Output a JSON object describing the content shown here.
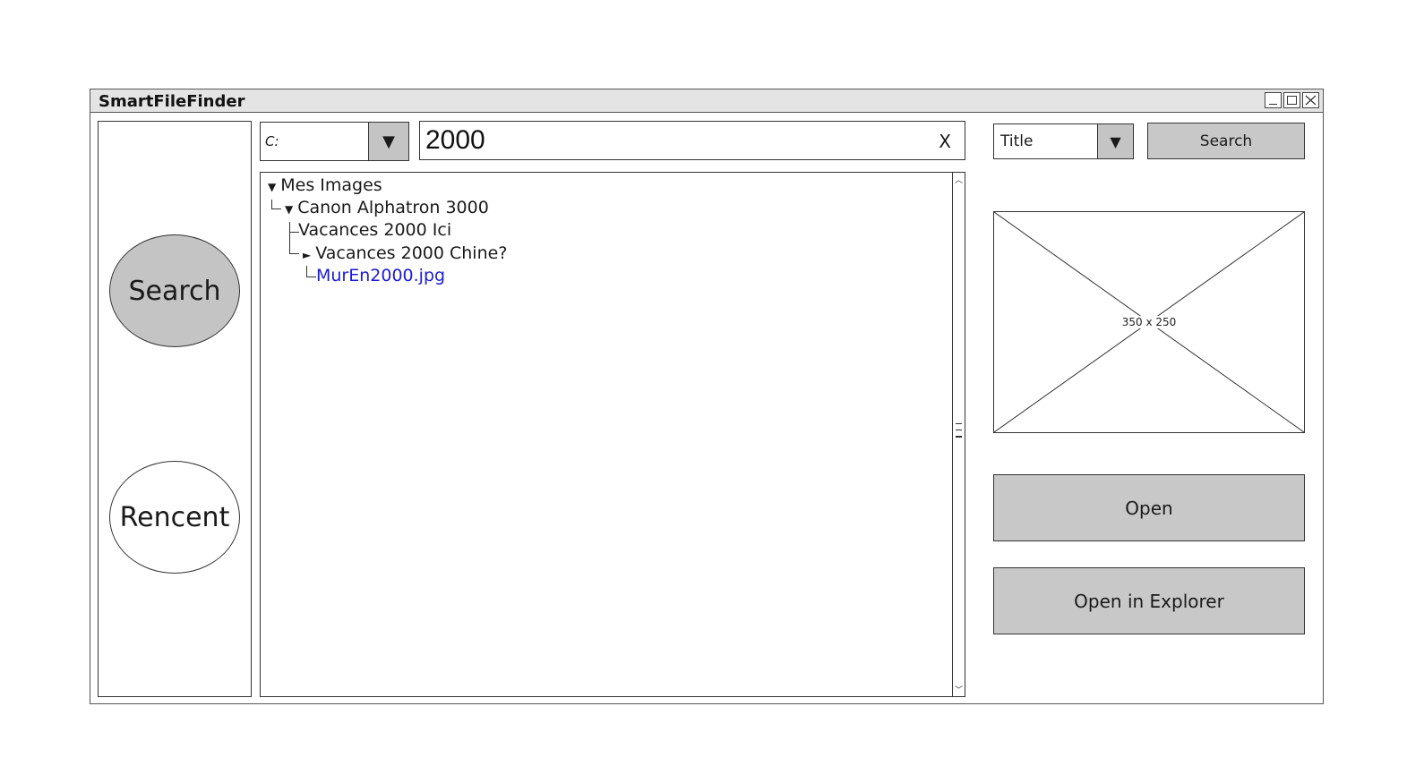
{
  "window": {
    "title": "SmartFileFinder"
  },
  "sidebar": {
    "search_label": "Search",
    "recent_label": "Rencent"
  },
  "drive_select": {
    "value": "C:"
  },
  "search": {
    "query": "2000",
    "clear_label": "X"
  },
  "tree": {
    "items": [
      {
        "label": "Mes Images",
        "marker": "▼"
      },
      {
        "label": "Canon Alphatron 3000",
        "marker": "▼"
      },
      {
        "label": "Vacances 2000 Ici",
        "marker": ""
      },
      {
        "label": "Vacances 2000 Chine?",
        "marker": "►"
      },
      {
        "label": "MurEn2000.jpg",
        "marker": ""
      }
    ]
  },
  "sort_select": {
    "value": "Title"
  },
  "search_button": {
    "label": "Search"
  },
  "preview": {
    "dimensions": "350 x 250"
  },
  "actions": {
    "open_label": "Open",
    "explorer_label": "Open in Explorer"
  },
  "colors": {
    "button_gray": "#c8c8c8",
    "link_blue": "#1a1adb",
    "titlebar": "#e4e4e4"
  },
  "icons": {
    "dropdown": "chevron-down-icon",
    "close": "close-icon",
    "minimize": "minimize-icon",
    "maximize": "maximize-icon"
  }
}
